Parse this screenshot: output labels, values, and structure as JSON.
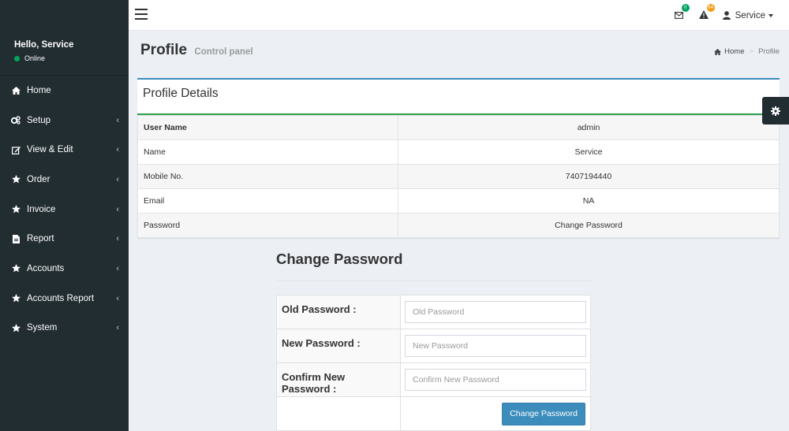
{
  "sidebar": {
    "greeting": "Hello, Service",
    "status": "Online",
    "status_color": "#00a65a",
    "items": [
      {
        "label": "Home",
        "icon": "home-icon",
        "has_children": false
      },
      {
        "label": "Setup",
        "icon": "cogs-icon",
        "has_children": true
      },
      {
        "label": "View & Edit",
        "icon": "edit-icon",
        "has_children": true
      },
      {
        "label": "Order",
        "icon": "star-icon",
        "has_children": true
      },
      {
        "label": "Invoice",
        "icon": "star-icon",
        "has_children": true
      },
      {
        "label": "Report",
        "icon": "file-icon",
        "has_children": true
      },
      {
        "label": "Accounts",
        "icon": "star-icon",
        "has_children": true
      },
      {
        "label": "Accounts Report",
        "icon": "star-icon",
        "has_children": true
      },
      {
        "label": "System",
        "icon": "star-icon",
        "has_children": true
      }
    ]
  },
  "topbar": {
    "messages_badge": "0",
    "alerts_badge": "64",
    "user_label": "Service"
  },
  "header": {
    "title": "Profile",
    "subtitle": "Control panel",
    "breadcrumb": {
      "home": "Home",
      "current": "Profile"
    }
  },
  "profile": {
    "title": "Profile Details",
    "rows": [
      {
        "label": "User Name",
        "value": "admin"
      },
      {
        "label": "Name",
        "value": "Service"
      },
      {
        "label": "Mobile No.",
        "value": "7407194440"
      },
      {
        "label": "Email",
        "value": "NA"
      },
      {
        "label": "Password",
        "value": "Change Password"
      }
    ]
  },
  "change_password": {
    "title": "Change Password",
    "old_label": "Old Password :",
    "old_placeholder": "Old Password",
    "new_label": "New Password :",
    "new_placeholder": "New Password",
    "confirm_label": "Confirm New Password :",
    "confirm_placeholder": "Confirm New Password",
    "button_label": "Change Password"
  },
  "colors": {
    "sidebar_bg": "#222d32",
    "primary": "#3c8dbc",
    "success": "#00a65a",
    "warning": "#f39c12"
  }
}
